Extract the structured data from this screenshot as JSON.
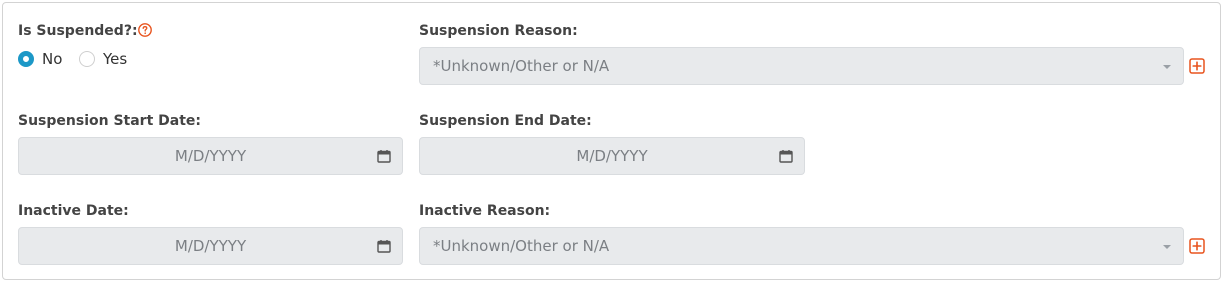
{
  "is_suspended": {
    "label": "Is Suspended?:",
    "help_icon": "question-circle-icon",
    "options": [
      {
        "label": "No",
        "checked": true
      },
      {
        "label": "Yes",
        "checked": false
      }
    ],
    "selected_color": "#1c98c7"
  },
  "suspension_reason": {
    "label": "Suspension Reason:",
    "value": "*Unknown/Other or N/A",
    "add_icon": "plus-square-icon"
  },
  "suspension_start_date": {
    "label": "Suspension Start Date:",
    "placeholder": "M/D/YYYY",
    "icon": "calendar-icon"
  },
  "suspension_end_date": {
    "label": "Suspension End Date:",
    "placeholder": "M/D/YYYY",
    "icon": "calendar-icon"
  },
  "inactive_date": {
    "label": "Inactive Date:",
    "placeholder": "M/D/YYYY",
    "icon": "calendar-icon"
  },
  "inactive_reason": {
    "label": "Inactive Reason:",
    "value": "*Unknown/Other or N/A",
    "add_icon": "plus-square-icon"
  },
  "colors": {
    "accent_orange": "#e8541e",
    "field_background": "#e8eaec",
    "radio_selected": "#1c98c7"
  }
}
